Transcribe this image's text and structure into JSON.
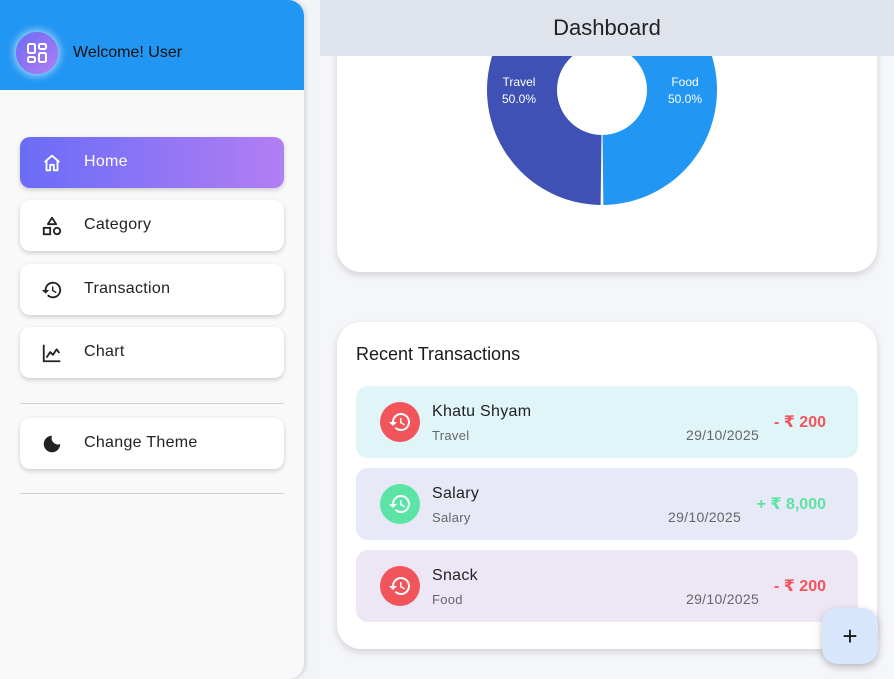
{
  "appbar": {
    "title": "Dashboard"
  },
  "drawer": {
    "welcome": "Welcome! User",
    "items": [
      {
        "label": "Home",
        "icon": "home-icon",
        "active": true
      },
      {
        "label": "Category",
        "icon": "category-icon",
        "active": false
      },
      {
        "label": "Transaction",
        "icon": "history-icon",
        "active": false
      },
      {
        "label": "Chart",
        "icon": "chart-icon",
        "active": false
      }
    ],
    "theme_label": "Change Theme",
    "colors": {
      "header": "#2196f3",
      "active_start": "#6a6cf6",
      "active_end": "#b27ef4"
    }
  },
  "chart_data": {
    "type": "pie",
    "categories": [
      "Food",
      "Travel"
    ],
    "values": [
      50.0,
      50.0
    ],
    "labels": [
      "50.0%",
      "50.0%"
    ],
    "colors": [
      "#2196f3",
      "#3f51b5"
    ]
  },
  "transactions": {
    "title": "Recent Transactions",
    "items": [
      {
        "name": "Khatu Shyam",
        "category": "Travel",
        "date": "29/10/2025",
        "amount": "- ₹ 200",
        "type": "expense"
      },
      {
        "name": "Salary",
        "category": "Salary",
        "date": "29/10/2025",
        "amount": "+ ₹ 8,000",
        "type": "income"
      },
      {
        "name": "Snack",
        "category": "Food",
        "date": "29/10/2025",
        "amount": "- ₹ 200",
        "type": "expense"
      }
    ],
    "colors": {
      "expense": "#f2545b",
      "income": "#5be4a5",
      "row1": "#dff5f8",
      "row2": "#e8e9f6",
      "row3": "#ede6f5"
    }
  },
  "fab": {
    "label": "+"
  }
}
